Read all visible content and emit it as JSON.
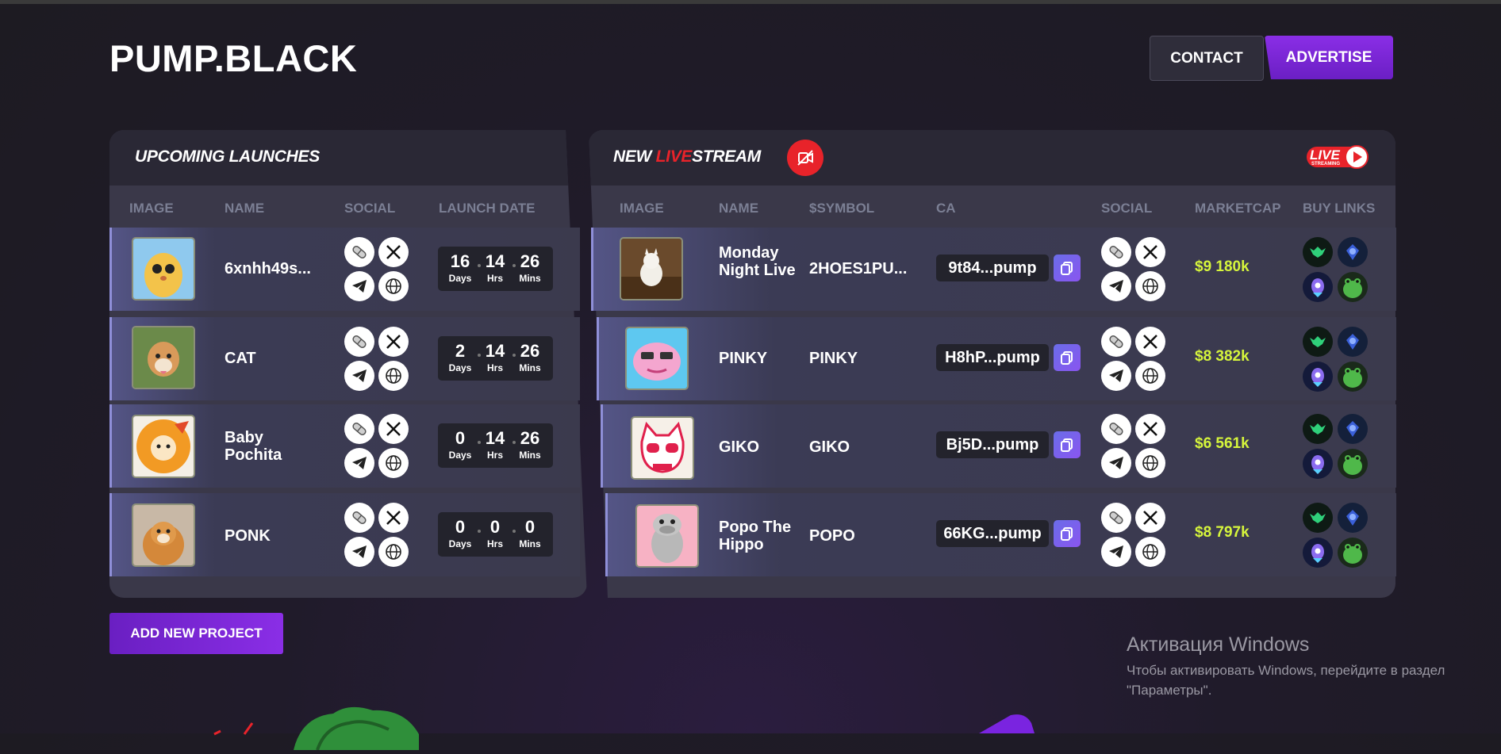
{
  "header": {
    "logo": "PUMP.BLACK",
    "contact_label": "CONTACT",
    "advertise_label": "ADVERTISE"
  },
  "upcoming": {
    "title": "UPCOMING LAUNCHES",
    "columns": [
      "IMAGE",
      "NAME",
      "SOCIAL",
      "LAUNCH DATE"
    ],
    "rows": [
      {
        "name": "6xnhh49s...",
        "days": "16",
        "hrs": "14",
        "mins": "26"
      },
      {
        "name": "CAT",
        "days": "2",
        "hrs": "14",
        "mins": "26"
      },
      {
        "name": "Baby Pochita",
        "days": "0",
        "hrs": "14",
        "mins": "26"
      },
      {
        "name": "PONK",
        "days": "0",
        "hrs": "0",
        "mins": "0"
      }
    ],
    "timer_labels": {
      "days": "Days",
      "hrs": "Hrs",
      "mins": "Mins"
    }
  },
  "livestream": {
    "title_prefix": "NEW ",
    "title_live": "LIVE",
    "title_suffix": "STREAM",
    "badge": {
      "live": "LIVE",
      "streaming": "STREAMING"
    },
    "columns": [
      "IMAGE",
      "NAME",
      "$SYMBOL",
      "CA",
      "SOCIAL",
      "MARKETCAP",
      "BUY LINKS"
    ],
    "rows": [
      {
        "name": "Monday Night Live",
        "symbol": "2HOES1PU...",
        "ca": "9t84...pump",
        "marketcap": "$9 180k"
      },
      {
        "name": "PINKY",
        "symbol": "PINKY",
        "ca": "H8hP...pump",
        "marketcap": "$8 382k"
      },
      {
        "name": "GIKO",
        "symbol": "GIKO",
        "ca": "Bj5D...pump",
        "marketcap": "$6 561k"
      },
      {
        "name": "Popo The Hippo",
        "symbol": "POPO",
        "ca": "66KG...pump",
        "marketcap": "$8 797k"
      }
    ]
  },
  "add_project_label": "ADD NEW PROJECT",
  "windows_activation": {
    "title": "Активация Windows",
    "line1": "Чтобы активировать Windows, перейдите в раздел",
    "line2": "\"Параметры\"."
  },
  "colors": {
    "accent": "#8a2ee6",
    "marketcap": "#d6f53c",
    "live_red": "#e8232a"
  }
}
